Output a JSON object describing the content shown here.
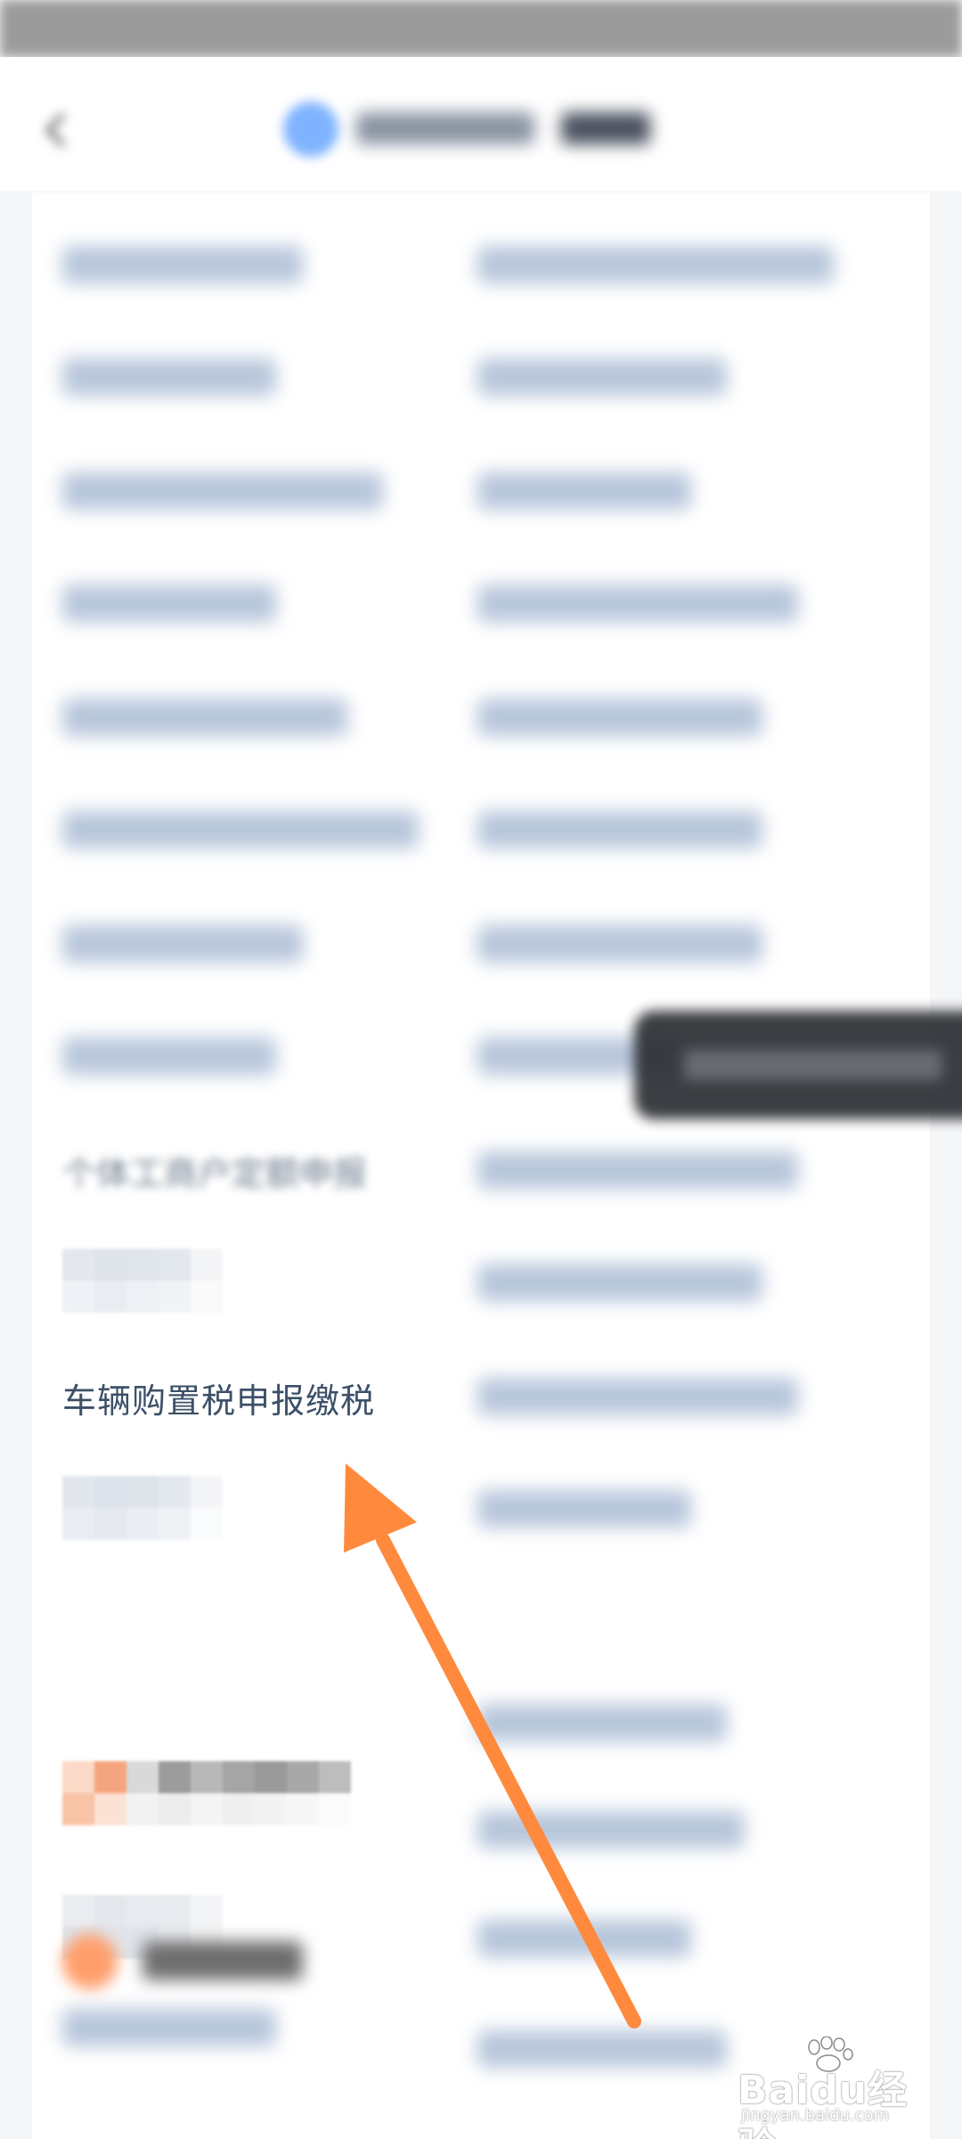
{
  "list": {
    "visible_item_label": "车辆购置税申报缴税",
    "partial_item_label": "个体工商户定额申报"
  },
  "watermark": {
    "brand_text": "Baidu经验",
    "url_text": "jingyan.baidu.com"
  },
  "colors": {
    "arrow": "#ff8a3d",
    "item_text": "#3c5068",
    "header_logo": "#7fb3ff"
  },
  "icons": {
    "back": "chevron-left-icon",
    "logo": "app-logo-icon",
    "watermark": "baidu-paw-icon"
  }
}
